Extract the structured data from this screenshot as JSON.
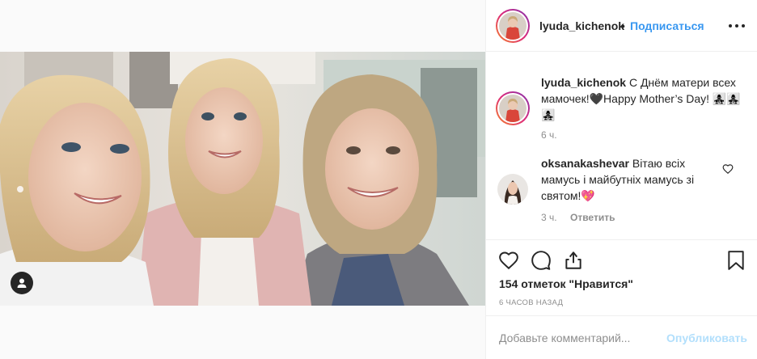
{
  "post": {
    "username": "lyuda_kichenok",
    "separator": "•",
    "follow_label": "Подписаться",
    "more_icon": "more-horizontal-icon",
    "photo_tag_icon": "user-tag-icon"
  },
  "caption": {
    "username": "lyuda_kichenok",
    "text": "С Днём матери всех мамочек!🖤Happy Mother’s Day! 👩‍👧‍👧👩‍👧‍👧👩‍👧‍👧",
    "time": "6 ч."
  },
  "comment": {
    "username": "oksanakashevar",
    "text": "Вітаю всіх мамусь і майбутніх мамусь зі святом!💖",
    "time": "3 ч.",
    "reply_label": "Ответить",
    "like_icon": "heart-outline-icon"
  },
  "actions": {
    "like_icon": "heart-outline-icon",
    "comment_icon": "comment-bubble-icon",
    "share_icon": "share-upload-icon",
    "save_icon": "bookmark-icon"
  },
  "likes_text": "154 отметок \"Нравится\"",
  "post_time": "6 часов назад",
  "add_comment": {
    "placeholder": "Добавьте комментарий...",
    "publish_label": "Опубликовать"
  },
  "colors": {
    "accent": "#3897f0",
    "publish_disabled": "#b2dffc",
    "muted": "#8e8e8e",
    "text": "#262626",
    "border": "#efefef"
  }
}
